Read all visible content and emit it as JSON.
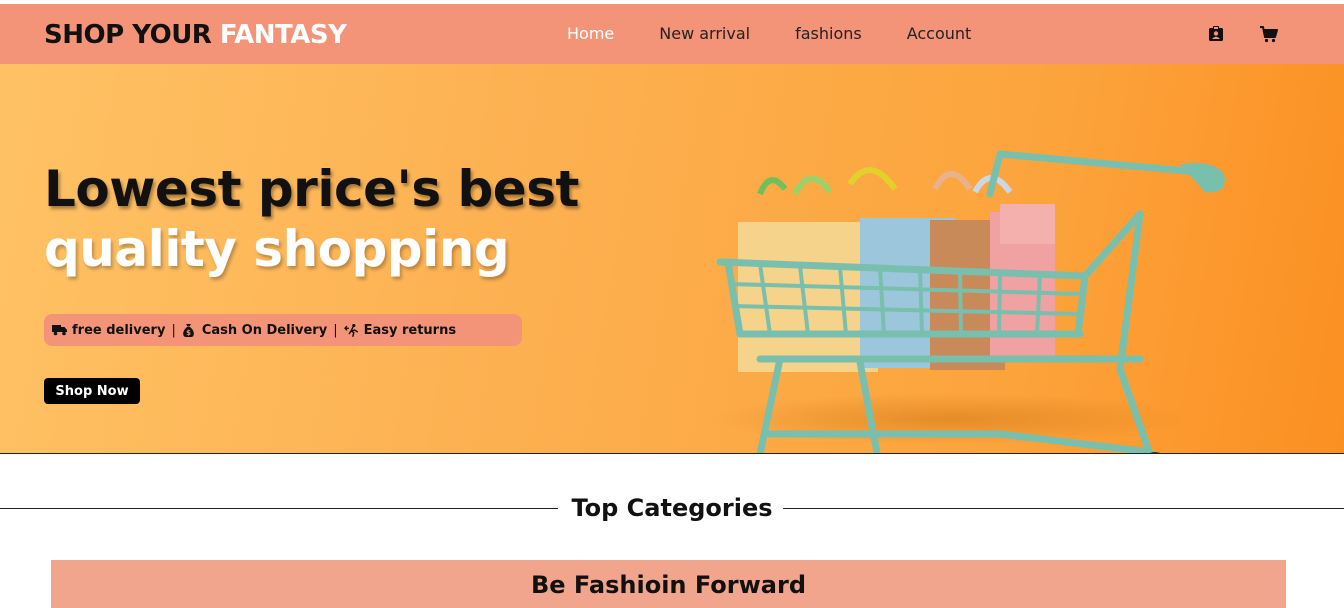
{
  "brand": {
    "part1": "SHOP YOUR ",
    "part2": "FANTASY"
  },
  "nav": {
    "links": [
      {
        "label": "Home",
        "active": true
      },
      {
        "label": "New arrival",
        "active": false
      },
      {
        "label": "fashions",
        "active": false
      },
      {
        "label": "Account",
        "active": false
      }
    ],
    "icons": [
      "id-badge-icon",
      "cart-icon"
    ]
  },
  "hero": {
    "title_line1": "Lowest price's best",
    "title_line2": "quality shopping",
    "features": [
      {
        "icon": "truck-icon",
        "label": "free delivery"
      },
      {
        "icon": "money-bag-icon",
        "label": "Cash On Delivery"
      },
      {
        "icon": "return-person-icon",
        "label": "Easy returns"
      }
    ],
    "cta_label": "Shop Now"
  },
  "categories": {
    "heading": "Top Categories",
    "banner_title": "Be Fashioin Forward"
  },
  "colors": {
    "navbar": "#f39478",
    "hero_start": "#fec265",
    "hero_end": "#fb8f22",
    "banner": "#f0a58c",
    "cart_frame": "#79bfae"
  }
}
